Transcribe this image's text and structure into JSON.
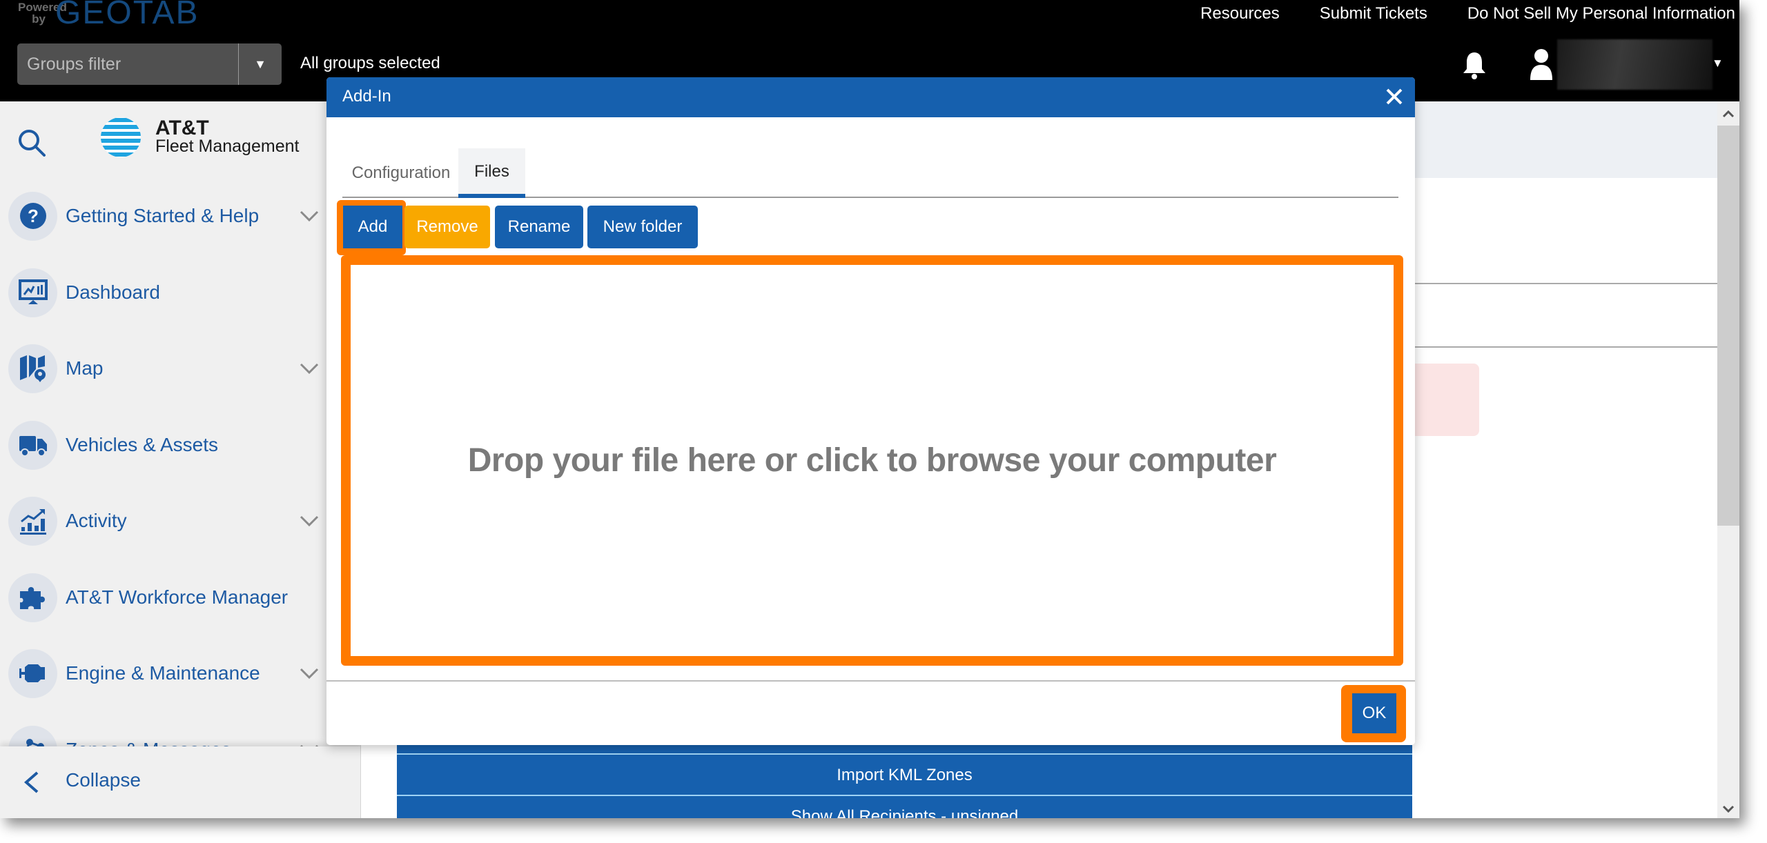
{
  "header": {
    "logo_powered": "Powered by",
    "logo_brand": "GEOTAB",
    "groups_filter_placeholder": "Groups filter",
    "groups_status": "All groups selected",
    "links": [
      "Resources",
      "Submit Tickets",
      "Do Not Sell My Personal Information"
    ]
  },
  "sidebar": {
    "brand_line1": "AT&T",
    "brand_line2": "Fleet Management",
    "items": [
      {
        "label": "Getting Started & Help",
        "icon": "help-circle-icon",
        "expandable": true
      },
      {
        "label": "Dashboard",
        "icon": "dashboard-monitor-icon",
        "expandable": false
      },
      {
        "label": "Map",
        "icon": "map-icon",
        "expandable": true
      },
      {
        "label": "Vehicles & Assets",
        "icon": "truck-icon",
        "expandable": false
      },
      {
        "label": "Activity",
        "icon": "activity-chart-icon",
        "expandable": true
      },
      {
        "label": "AT&T Workforce Manager",
        "icon": "puzzle-icon",
        "expandable": false
      },
      {
        "label": "Engine & Maintenance",
        "icon": "engine-icon",
        "expandable": true
      },
      {
        "label": "Zones & Messages",
        "icon": "zones-icon",
        "expandable": true
      }
    ],
    "collapse_label": "Collapse"
  },
  "background": {
    "rows": [
      "Import KML Zones",
      "Show All Recipients - unsigned"
    ]
  },
  "dialog": {
    "title": "Add-In",
    "tabs": [
      {
        "label": "Configuration",
        "active": false
      },
      {
        "label": "Files",
        "active": true
      }
    ],
    "buttons": {
      "add": "Add",
      "remove": "Remove",
      "rename": "Rename",
      "new_folder": "New folder"
    },
    "dropzone_text": "Drop your file here or click to browse your computer",
    "ok_label": "OK"
  },
  "colors": {
    "primary_blue": "#1660ae",
    "warning_yellow": "#f9a800",
    "highlight_orange": "#ff7a00",
    "topbar": "#000000"
  }
}
